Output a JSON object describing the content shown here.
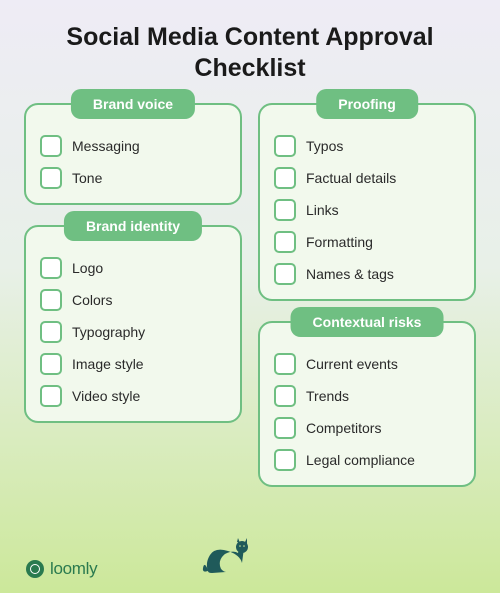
{
  "title": "Social Media Content Approval Checklist",
  "brand": "loomly",
  "sections": {
    "brandVoice": {
      "title": "Brand voice",
      "items": [
        "Messaging",
        "Tone"
      ]
    },
    "brandIdentity": {
      "title": "Brand identity",
      "items": [
        "Logo",
        "Colors",
        "Typography",
        "Image style",
        "Video style"
      ]
    },
    "proofing": {
      "title": "Proofing",
      "items": [
        "Typos",
        "Factual details",
        "Links",
        "Formatting",
        "Names & tags"
      ]
    },
    "contextualRisks": {
      "title": "Contextual risks",
      "items": [
        "Current events",
        "Trends",
        "Competitors",
        "Legal compliance"
      ]
    }
  }
}
